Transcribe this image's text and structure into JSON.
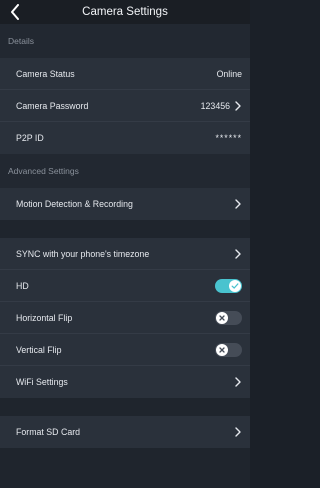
{
  "header": {
    "title": "Camera Settings"
  },
  "details": {
    "section_label": "Details",
    "camera_status": {
      "label": "Camera Status",
      "value": "Online"
    },
    "camera_password": {
      "label": "Camera Password",
      "value": "123456"
    },
    "p2p_id": {
      "label": "P2P ID",
      "value": "******"
    }
  },
  "advanced": {
    "section_label": "Advanced Settings",
    "motion": {
      "label": "Motion Detection & Recording"
    },
    "sync": {
      "label": "SYNC with your phone's timezone"
    },
    "hd": {
      "label": "HD",
      "on": true
    },
    "hflip": {
      "label": "Horizontal Flip",
      "on": false
    },
    "vflip": {
      "label": "Vertical Flip",
      "on": false
    },
    "wifi": {
      "label": "WiFi Settings"
    },
    "format": {
      "label": "Format SD Card"
    }
  },
  "colors": {
    "toggle_on": "#49c3cf",
    "toggle_off": "#454c57",
    "background": "#1b2028"
  }
}
